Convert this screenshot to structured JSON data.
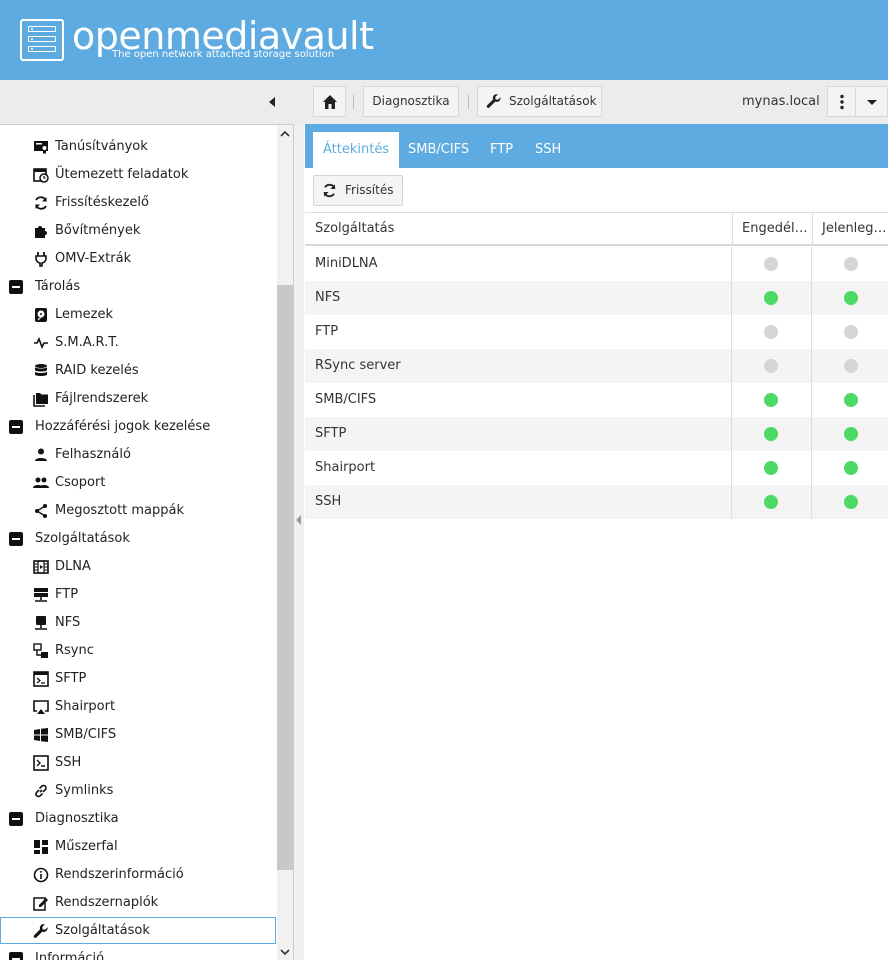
{
  "header": {
    "logo_text": "openmediavault",
    "tagline": "The open network attached storage solution"
  },
  "toolbar": {
    "crumbs": [
      "Diagnosztika",
      "Szolgáltatások"
    ],
    "hostname": "mynas.local"
  },
  "sidebar": {
    "items": [
      {
        "label": "Tanúsítványok",
        "icon": "certificate-icon",
        "level": 1
      },
      {
        "label": "Ütemezett feladatok",
        "icon": "calendar-clock-icon",
        "level": 1
      },
      {
        "label": "Frissítéskezelő",
        "icon": "sync-icon",
        "level": 1
      },
      {
        "label": "Bővítmények",
        "icon": "puzzle-icon",
        "level": 1
      },
      {
        "label": "OMV-Extrák",
        "icon": "plug-icon",
        "level": 1
      },
      {
        "label": "Tárolás",
        "icon": "collapse-icon",
        "level": 0
      },
      {
        "label": "Lemezek",
        "icon": "harddisk-icon",
        "level": 1
      },
      {
        "label": "S.M.A.R.T.",
        "icon": "pulse-icon",
        "level": 1
      },
      {
        "label": "RAID kezelés",
        "icon": "database-icon",
        "level": 1
      },
      {
        "label": "Fájlrendszerek",
        "icon": "folders-icon",
        "level": 1
      },
      {
        "label": "Hozzáférési jogok kezelése",
        "icon": "collapse-icon",
        "level": 0
      },
      {
        "label": "Felhasználó",
        "icon": "user-icon",
        "level": 1
      },
      {
        "label": "Csoport",
        "icon": "group-icon",
        "level": 1
      },
      {
        "label": "Megosztott mappák",
        "icon": "share-icon",
        "level": 1
      },
      {
        "label": "Szolgáltatások",
        "icon": "collapse-icon",
        "level": 0
      },
      {
        "label": "DLNA",
        "icon": "film-icon",
        "level": 1
      },
      {
        "label": "FTP",
        "icon": "server-network-icon",
        "level": 1
      },
      {
        "label": "NFS",
        "icon": "nas-icon",
        "level": 1
      },
      {
        "label": "Rsync",
        "icon": "rsync-icon",
        "level": 1
      },
      {
        "label": "SFTP",
        "icon": "console-window-icon",
        "level": 1
      },
      {
        "label": "Shairport",
        "icon": "airplay-icon",
        "level": 1
      },
      {
        "label": "SMB/CIFS",
        "icon": "windows-icon",
        "level": 1
      },
      {
        "label": "SSH",
        "icon": "console-icon",
        "level": 1
      },
      {
        "label": "Symlinks",
        "icon": "link-icon",
        "level": 1
      },
      {
        "label": "Diagnosztika",
        "icon": "collapse-icon",
        "level": 0
      },
      {
        "label": "Műszerfal",
        "icon": "dashboard-icon",
        "level": 1
      },
      {
        "label": "Rendszerinformáció",
        "icon": "info-icon",
        "level": 1
      },
      {
        "label": "Rendszernaplók",
        "icon": "log-edit-icon",
        "level": 1
      },
      {
        "label": "Szolgáltatások",
        "icon": "wrench-icon",
        "level": 1,
        "selected": true
      },
      {
        "label": "Információ",
        "icon": "collapse-icon",
        "level": 0
      }
    ]
  },
  "tabs": [
    "Áttekintés",
    "SMB/CIFS",
    "FTP",
    "SSH"
  ],
  "active_tab": "Áttekintés",
  "actions": {
    "refresh_label": "Frissítés"
  },
  "grid": {
    "columns": [
      "Szolgáltatás",
      "Engedélyezett",
      "Jelenleg fut"
    ],
    "rows": [
      {
        "name": "MiniDLNA",
        "enabled": false,
        "running": false
      },
      {
        "name": "NFS",
        "enabled": true,
        "running": true
      },
      {
        "name": "FTP",
        "enabled": false,
        "running": false
      },
      {
        "name": "RSync server",
        "enabled": false,
        "running": false
      },
      {
        "name": "SMB/CIFS",
        "enabled": true,
        "running": true
      },
      {
        "name": "SFTP",
        "enabled": true,
        "running": true
      },
      {
        "name": "Shairport",
        "enabled": true,
        "running": true
      },
      {
        "name": "SSH",
        "enabled": true,
        "running": true
      }
    ]
  },
  "colors": {
    "accent": "#5dabe0",
    "status_on": "#4cd964",
    "status_off": "#d5d5d5"
  }
}
